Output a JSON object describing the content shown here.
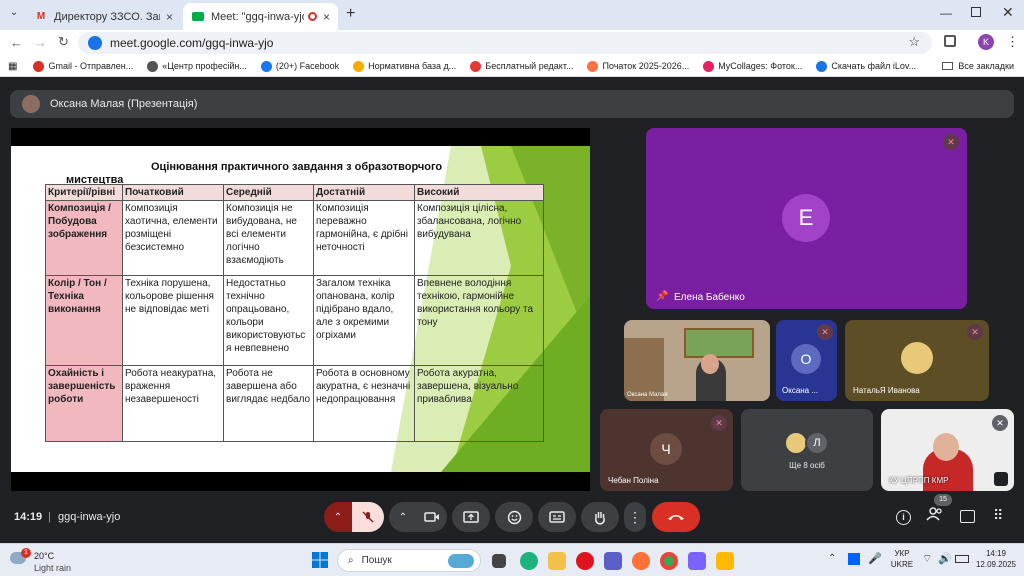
{
  "browser": {
    "tabs": [
      {
        "title": "Директору ЗЗСО. Запрошення",
        "favicon": "M"
      },
      {
        "title": "Meet: \"ggq-inwa-yjo\"",
        "favicon": "meet"
      }
    ],
    "new_tab": "+",
    "url": "meet.google.com/ggq-inwa-yjo",
    "profile_initial": "K",
    "bookmarks": [
      {
        "label": "Gmail - Отправлен...",
        "color": "#d93025"
      },
      {
        "label": "«Центр професійн...",
        "color": "#555"
      },
      {
        "label": "(20+) Facebook",
        "color": "#1877f2"
      },
      {
        "label": "Нормативна база д...",
        "color": "#f9ab00"
      },
      {
        "label": "Бесплатный редакт...",
        "color": "#e53935"
      },
      {
        "label": "Початок 2025-2026...",
        "color": "#ff7043"
      },
      {
        "label": "MyCollages: Фоток...",
        "color": "#e91e63"
      },
      {
        "label": "Скачать файл iLov...",
        "color": "#1a73e8"
      }
    ],
    "all_bookmarks": "Все закладки"
  },
  "meet": {
    "presenter_label": "Оксана Малая (Презентація)",
    "slide": {
      "title_line1": "Оцінювання практичного завдання з образотворчого",
      "title_line2": "мистецтва",
      "headers": [
        "Критерії/рівні",
        "Початковий",
        "Середній",
        "Достатній",
        "Високий"
      ],
      "rows": [
        {
          "criterion": "Композиція / Побудова зображення",
          "cells": [
            "Композиція хаотична, елементи розміщені безсистемно",
            "Композиція не вибудована, не всі елементи логічно взаємодіють",
            "Композиція переважно гармонійна, є дрібні неточності",
            "Композиція цілісна, збалансована, логічно вибудувана"
          ]
        },
        {
          "criterion": "Колір / Тон / Техніка виконання",
          "cells": [
            "Техніка порушена, кольорове рішення не відповідає меті",
            "Недостатньо технічно опрацьовано, кольори використовуютьс я невпевнено",
            "Загалом техніка опанована, колір підібрано вдало, але з окремими огріхами",
            "Впевнене володіння технікою, гармонійне використання кольору та тону"
          ]
        },
        {
          "criterion": "Охайність і завершеність роботи",
          "cells": [
            "Робота неакуратна, враження незавершеності",
            "Робота не завершена або виглядає недбало",
            "Робота в основному акуратна, є незначні недопрацювання",
            "Робота акуратна, завершена, візуально приваблива"
          ]
        }
      ]
    },
    "participants": [
      {
        "name": "Елена Бабенко",
        "initial": "Е",
        "color": "#8e24aa"
      },
      {
        "name": "Оксана Малая",
        "initial": ""
      },
      {
        "name": "Оксана ...",
        "initial": "О",
        "color": "#5c6bc0"
      },
      {
        "name": "НатальЯ Иванова",
        "initial": ""
      },
      {
        "name": "Чебан Поліна",
        "initial": "Ч",
        "color": "#6d4c41"
      },
      {
        "name": "Ще 8 осіб",
        "initial": "Л"
      },
      {
        "name": "КУ ЦПРПП КМР",
        "initial": ""
      }
    ],
    "time": "14:19",
    "meeting_code": "ggq-inwa-yjo",
    "participants_count": "15"
  },
  "taskbar": {
    "weather_temp": "20°C",
    "weather_desc": "Light rain",
    "weather_badge": "1",
    "search_placeholder": "Пошук",
    "lang_top": "УКР",
    "lang_bottom": "UKRE",
    "clock_time": "14:19",
    "clock_date": "12.09.2025"
  }
}
